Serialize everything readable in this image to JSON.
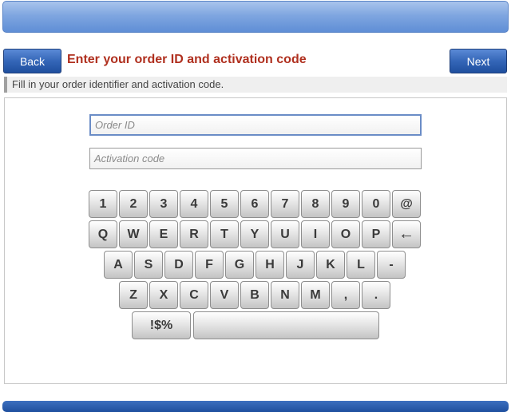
{
  "header": {
    "back_label": "Back",
    "next_label": "Next",
    "title": "Enter your order ID and activation code",
    "instruction": "Fill in your order identifier and activation code."
  },
  "form": {
    "order_id": {
      "value": "",
      "placeholder": "Order ID"
    },
    "activation_code": {
      "value": "",
      "placeholder": "Activation code"
    }
  },
  "keyboard": {
    "rows": [
      [
        "1",
        "2",
        "3",
        "4",
        "5",
        "6",
        "7",
        "8",
        "9",
        "0",
        "@"
      ],
      [
        "Q",
        "W",
        "E",
        "R",
        "T",
        "Y",
        "U",
        "I",
        "O",
        "P",
        "←"
      ],
      [
        "A",
        "S",
        "D",
        "F",
        "G",
        "H",
        "J",
        "K",
        "L",
        "-"
      ],
      [
        "Z",
        "X",
        "C",
        "V",
        "B",
        "N",
        "M",
        ",",
        "."
      ]
    ],
    "symbols_label": "!$%",
    "space_label": ""
  },
  "colors": {
    "title": "#b0301f",
    "button": "#3466b8",
    "topbar": "#7fa6e0"
  }
}
